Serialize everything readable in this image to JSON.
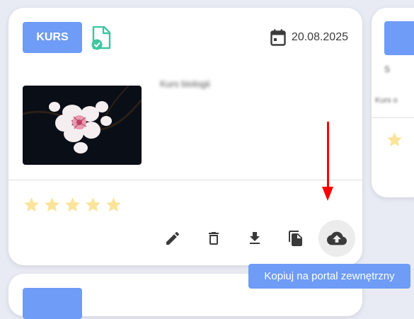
{
  "card": {
    "badge": "KURS",
    "file_icon": "file-check-icon",
    "date": "20.08.2025",
    "title": "Kurs biologii",
    "rating": {
      "value": 0,
      "max": 5
    },
    "actions": [
      {
        "icon": "edit-icon",
        "label": "Edytuj"
      },
      {
        "icon": "delete-icon",
        "label": "Usuń"
      },
      {
        "icon": "download-icon",
        "label": "Pobierz"
      },
      {
        "icon": "copy-icon",
        "label": "Kopiuj"
      },
      {
        "icon": "cloud-upload-icon",
        "label": "Kopiuj na portal zewnętrzny"
      }
    ]
  },
  "tooltip": "Kopiuj na portal zewnętrzny",
  "side_card": {
    "line1": "S",
    "line2": "Kurs o"
  },
  "colors": {
    "accent": "#6e9cf6",
    "file_icon": "#3ec6a0",
    "star": "#fbe49a",
    "arrow": "#ff0000"
  }
}
